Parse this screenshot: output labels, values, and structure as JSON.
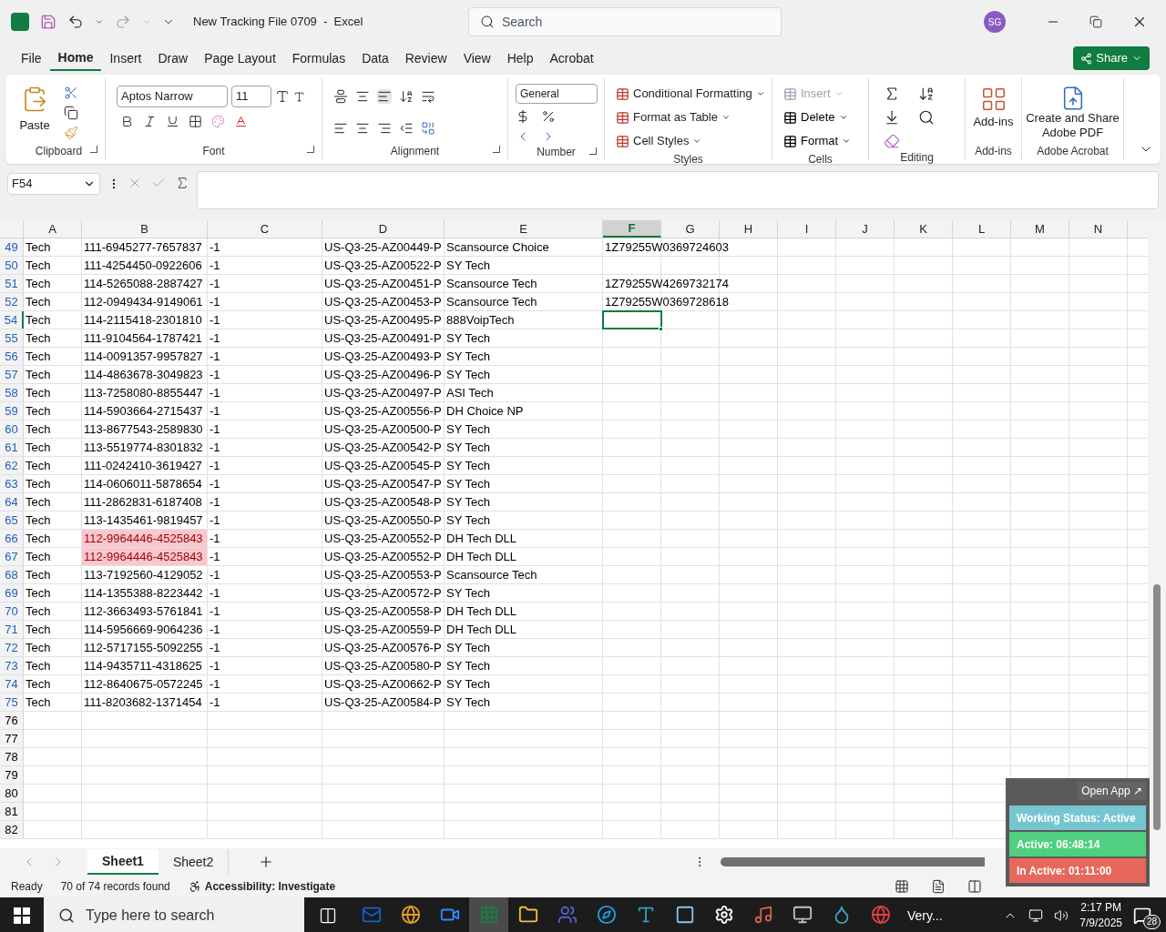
{
  "title_bar": {
    "title": "New Tracking File 0709  -  Excel",
    "search_placeholder": "Search",
    "avatar": "SG"
  },
  "menu_tabs": [
    {
      "label": "File",
      "selected": false
    },
    {
      "label": "Home",
      "selected": true
    },
    {
      "label": "Insert",
      "selected": false
    },
    {
      "label": "Draw",
      "selected": false
    },
    {
      "label": "Page Layout",
      "selected": false
    },
    {
      "label": "Formulas",
      "selected": false
    },
    {
      "label": "Data",
      "selected": false
    },
    {
      "label": "Review",
      "selected": false
    },
    {
      "label": "View",
      "selected": false
    },
    {
      "label": "Help",
      "selected": false
    },
    {
      "label": "Acrobat",
      "selected": false
    }
  ],
  "share_button": "Share",
  "ribbon": {
    "clipboard": {
      "paste": "Paste",
      "label": "Clipboard"
    },
    "font": {
      "name": "Aptos Narrow",
      "size": "11",
      "label": "Font"
    },
    "alignment": {
      "label": "Alignment"
    },
    "number": {
      "format": "General",
      "label": "Number"
    },
    "styles": {
      "items": [
        "Conditional Formatting",
        "Format as Table",
        "Cell Styles"
      ],
      "label": "Styles"
    },
    "cells": {
      "items": [
        {
          "label": "Insert",
          "disabled": true
        },
        {
          "label": "Delete",
          "disabled": false
        },
        {
          "label": "Format",
          "disabled": false
        }
      ],
      "label": "Cells"
    },
    "editing": {
      "label": "Editing"
    },
    "addins": {
      "button": "Add-ins",
      "label": "Add-ins"
    },
    "acrobat": {
      "button": "Create and Share Adobe PDF",
      "label": "Adobe Acrobat"
    }
  },
  "name_box": "F54",
  "columns": [
    {
      "label": "A",
      "selected": false
    },
    {
      "label": "B",
      "selected": false
    },
    {
      "label": "C",
      "selected": false
    },
    {
      "label": "D",
      "selected": false
    },
    {
      "label": "E",
      "selected": false
    },
    {
      "label": "F",
      "selected": true
    },
    {
      "label": "G",
      "selected": false
    },
    {
      "label": "H",
      "selected": false
    },
    {
      "label": "I",
      "selected": false
    },
    {
      "label": "J",
      "selected": false
    },
    {
      "label": "K",
      "selected": false
    },
    {
      "label": "L",
      "selected": false
    },
    {
      "label": "M",
      "selected": false
    },
    {
      "label": "N",
      "selected": false
    }
  ],
  "rows": [
    {
      "n": "49",
      "cells": [
        "Tech",
        "111-6945277-7657837",
        "-1",
        "US-Q3-25-AZ00449-P",
        "Scansource Choice",
        "1Z79255W0369724603"
      ],
      "selected": false,
      "duplicate": false,
      "filtered": true
    },
    {
      "n": "50",
      "cells": [
        "Tech",
        "111-4254450-0922606",
        "-1",
        "US-Q3-25-AZ00522-P",
        "SY Tech"
      ],
      "selected": false,
      "duplicate": false,
      "filtered": true
    },
    {
      "n": "51",
      "cells": [
        "Tech",
        "114-5265088-2887427",
        "-1",
        "US-Q3-25-AZ00451-P",
        "Scansource Tech",
        "1Z79255W4269732174"
      ],
      "selected": false,
      "duplicate": false,
      "filtered": true
    },
    {
      "n": "52",
      "cells": [
        "Tech",
        "112-0949434-9149061",
        "-1",
        "US-Q3-25-AZ00453-P",
        "Scansource Tech",
        "1Z79255W0369728618"
      ],
      "selected": false,
      "duplicate": false,
      "filtered": true
    },
    {
      "n": "54",
      "cells": [
        "Tech",
        "114-2115418-2301810",
        "-1",
        "US-Q3-25-AZ00495-P",
        "888VoipTech"
      ],
      "selected": true,
      "duplicate": false,
      "filtered": true
    },
    {
      "n": "55",
      "cells": [
        "Tech",
        "111-9104564-1787421",
        "-1",
        "US-Q3-25-AZ00491-P",
        "SY Tech"
      ],
      "selected": false,
      "duplicate": false,
      "filtered": true
    },
    {
      "n": "56",
      "cells": [
        "Tech",
        "114-0091357-9957827",
        "-1",
        "US-Q3-25-AZ00493-P",
        "SY Tech"
      ],
      "selected": false,
      "duplicate": false,
      "filtered": true
    },
    {
      "n": "57",
      "cells": [
        "Tech",
        "114-4863678-3049823",
        "-1",
        "US-Q3-25-AZ00496-P",
        "SY Tech"
      ],
      "selected": false,
      "duplicate": false,
      "filtered": true
    },
    {
      "n": "58",
      "cells": [
        "Tech",
        "113-7258080-8855447",
        "-1",
        "US-Q3-25-AZ00497-P",
        "ASI Tech"
      ],
      "selected": false,
      "duplicate": false,
      "filtered": true
    },
    {
      "n": "59",
      "cells": [
        "Tech",
        "114-5903664-2715437",
        "-1",
        "US-Q3-25-AZ00556-P",
        "DH Choice NP"
      ],
      "selected": false,
      "duplicate": false,
      "filtered": true
    },
    {
      "n": "60",
      "cells": [
        "Tech",
        "113-8677543-2589830",
        "-1",
        "US-Q3-25-AZ00500-P",
        "SY Tech"
      ],
      "selected": false,
      "duplicate": false,
      "filtered": true
    },
    {
      "n": "61",
      "cells": [
        "Tech",
        "113-5519774-8301832",
        "-1",
        "US-Q3-25-AZ00542-P",
        "SY Tech"
      ],
      "selected": false,
      "duplicate": false,
      "filtered": true
    },
    {
      "n": "62",
      "cells": [
        "Tech",
        "111-0242410-3619427",
        "-1",
        "US-Q3-25-AZ00545-P",
        "SY Tech"
      ],
      "selected": false,
      "duplicate": false,
      "filtered": true
    },
    {
      "n": "63",
      "cells": [
        "Tech",
        "114-0606011-5878654",
        "-1",
        "US-Q3-25-AZ00547-P",
        "SY Tech"
      ],
      "selected": false,
      "duplicate": false,
      "filtered": true
    },
    {
      "n": "64",
      "cells": [
        "Tech",
        "111-2862831-6187408",
        "-1",
        "US-Q3-25-AZ00548-P",
        "SY Tech"
      ],
      "selected": false,
      "duplicate": false,
      "filtered": true
    },
    {
      "n": "65",
      "cells": [
        "Tech",
        "113-1435461-9819457",
        "-1",
        "US-Q3-25-AZ00550-P",
        "SY Tech"
      ],
      "selected": false,
      "duplicate": false,
      "filtered": true
    },
    {
      "n": "66",
      "cells": [
        "Tech",
        "112-9964446-4525843",
        "-1",
        "US-Q3-25-AZ00552-P",
        "DH Tech DLL"
      ],
      "selected": false,
      "duplicate": true,
      "filtered": true
    },
    {
      "n": "67",
      "cells": [
        "Tech",
        "112-9964446-4525843",
        "-1",
        "US-Q3-25-AZ00552-P",
        "DH Tech DLL"
      ],
      "selected": false,
      "duplicate": true,
      "filtered": true
    },
    {
      "n": "68",
      "cells": [
        "Tech",
        "113-7192560-4129052",
        "-1",
        "US-Q3-25-AZ00553-P",
        "Scansource Tech"
      ],
      "selected": false,
      "duplicate": false,
      "filtered": true
    },
    {
      "n": "69",
      "cells": [
        "Tech",
        "114-1355388-8223442",
        "-1",
        "US-Q3-25-AZ00572-P",
        "SY Tech"
      ],
      "selected": false,
      "duplicate": false,
      "filtered": true
    },
    {
      "n": "70",
      "cells": [
        "Tech",
        "112-3663493-5761841",
        "-1",
        "US-Q3-25-AZ00558-P",
        "DH Tech DLL"
      ],
      "selected": false,
      "duplicate": false,
      "filtered": true
    },
    {
      "n": "71",
      "cells": [
        "Tech",
        "114-5956669-9064236",
        "-1",
        "US-Q3-25-AZ00559-P",
        "DH Tech DLL"
      ],
      "selected": false,
      "duplicate": false,
      "filtered": true
    },
    {
      "n": "72",
      "cells": [
        "Tech",
        "112-5717155-5092255",
        "-1",
        "US-Q3-25-AZ00576-P",
        "SY Tech"
      ],
      "selected": false,
      "duplicate": false,
      "filtered": true
    },
    {
      "n": "73",
      "cells": [
        "Tech",
        "114-9435711-4318625",
        "-1",
        "US-Q3-25-AZ00580-P",
        "SY Tech"
      ],
      "selected": false,
      "duplicate": false,
      "filtered": true
    },
    {
      "n": "74",
      "cells": [
        "Tech",
        "112-8640675-0572245",
        "-1",
        "US-Q3-25-AZ00662-P",
        "SY Tech"
      ],
      "selected": false,
      "duplicate": false,
      "filtered": true
    },
    {
      "n": "75",
      "cells": [
        "Tech",
        "111-8203682-1371454",
        "-1",
        "US-Q3-25-AZ00584-P",
        "SY Tech"
      ],
      "selected": false,
      "duplicate": false,
      "filtered": true
    },
    {
      "n": "76",
      "selected": false,
      "duplicate": false,
      "filtered": false
    },
    {
      "n": "77",
      "selected": false,
      "duplicate": false,
      "filtered": false
    },
    {
      "n": "78",
      "selected": false,
      "duplicate": false,
      "filtered": false
    },
    {
      "n": "79",
      "selected": false,
      "duplicate": false,
      "filtered": false
    },
    {
      "n": "80",
      "selected": false,
      "duplicate": false,
      "filtered": false
    },
    {
      "n": "81",
      "selected": false,
      "duplicate": false,
      "filtered": false
    },
    {
      "n": "82",
      "selected": false,
      "duplicate": false,
      "filtered": false
    }
  ],
  "sheet_tabs": [
    {
      "label": "Sheet1",
      "selected": true
    },
    {
      "label": "Sheet2",
      "selected": false
    }
  ],
  "status_bar": {
    "ready": "Ready",
    "records": "70 of 74 records found",
    "accessibility": "Accessibility: Investigate"
  },
  "tracker_widget": {
    "open_app": "Open App ↗",
    "statuses": [
      {
        "text": "Working Status: Active",
        "color": "#76c6d2"
      },
      {
        "text": "Active: 06:48:14",
        "color": "#4fcf7f"
      },
      {
        "text": "In Active: 01:11:00",
        "color": "#e8675c"
      }
    ]
  },
  "taskbar": {
    "search_placeholder": "Type here to search",
    "apps": [
      {
        "selected": false
      },
      {
        "selected": false
      },
      {
        "selected": false
      },
      {
        "selected": true
      },
      {
        "selected": false
      },
      {
        "selected": false
      },
      {
        "selected": false
      },
      {
        "selected": false
      },
      {
        "selected": false
      },
      {
        "selected": false
      },
      {
        "selected": false
      },
      {
        "selected": false
      },
      {
        "selected": false
      },
      {
        "selected": false
      }
    ],
    "weather": "Very...",
    "time": "2:17 PM",
    "date": "7/9/2025",
    "notifications": "28"
  }
}
